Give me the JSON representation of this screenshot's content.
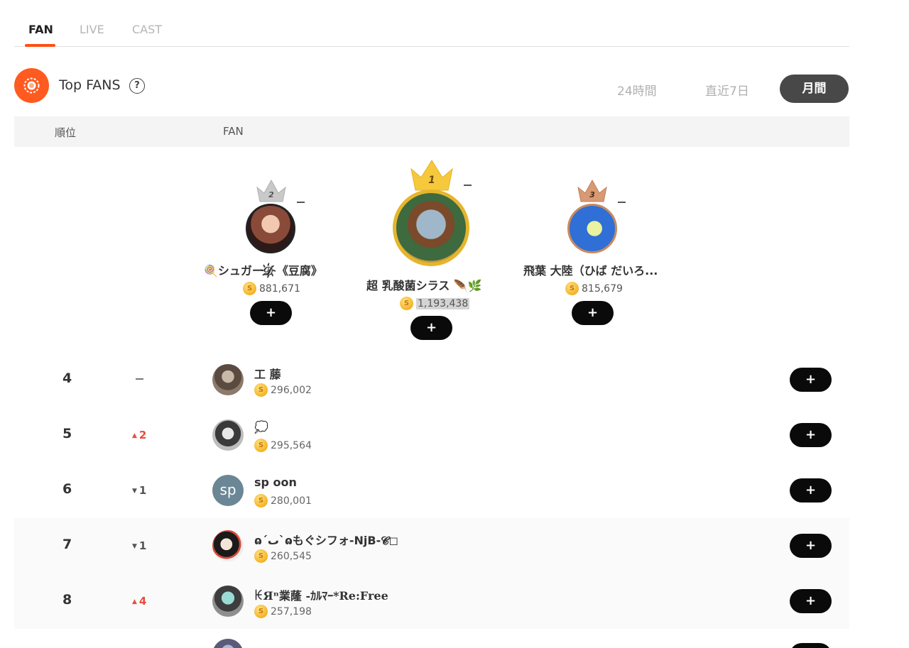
{
  "tabs": [
    {
      "label": "FAN",
      "active": true
    },
    {
      "label": "LIVE",
      "active": false
    },
    {
      "label": "CAST",
      "active": false
    }
  ],
  "section": {
    "title": "Top FANS",
    "help_icon": "question-circle-icon",
    "medal_icon": "badge-icon",
    "accent_color": "#ff5a1f"
  },
  "periods": [
    {
      "label": "24時間",
      "active": false
    },
    {
      "label": "直近7日",
      "active": false
    },
    {
      "label": "月間",
      "active": true
    }
  ],
  "table_header": {
    "rank": "順位",
    "fan": "FAN"
  },
  "podium": [
    {
      "rank": "2",
      "name": "🍭シュガー𝓓҉《豆腐》",
      "coins": "881,671",
      "change": "–",
      "crown_color": "#c0c0c0"
    },
    {
      "rank": "1",
      "name": "超 乳酸菌シラス 🪶🌿",
      "coins": "1,193,438",
      "change": "–",
      "crown_color": "#f5c23b"
    },
    {
      "rank": "3",
      "name": "飛葉 大陸（ひば だいろ...",
      "coins": "815,679",
      "change": "–",
      "crown_color": "#cd8a5f"
    }
  ],
  "add_button_label": "+",
  "rows": [
    {
      "rank": "4",
      "change": "–",
      "direction": "none",
      "name": "工 藤",
      "coins": "296,002"
    },
    {
      "rank": "5",
      "change": "2",
      "direction": "up",
      "name": "💭",
      "coins": "295,564"
    },
    {
      "rank": "6",
      "change": "1",
      "direction": "down",
      "name": "sp oon",
      "coins": "280,001",
      "avatar_text": "sp"
    },
    {
      "rank": "7",
      "change": "1",
      "direction": "down",
      "name": "ɷ´ٮ`ɷもぐシフォ-NjB-𝓒◻︎",
      "coins": "260,545"
    },
    {
      "rank": "8",
      "change": "4",
      "direction": "up",
      "name": "ꀘЯⁿ業蕯 -ｶﾙﾏｰ*Re:Free",
      "coins": "257,198"
    }
  ]
}
